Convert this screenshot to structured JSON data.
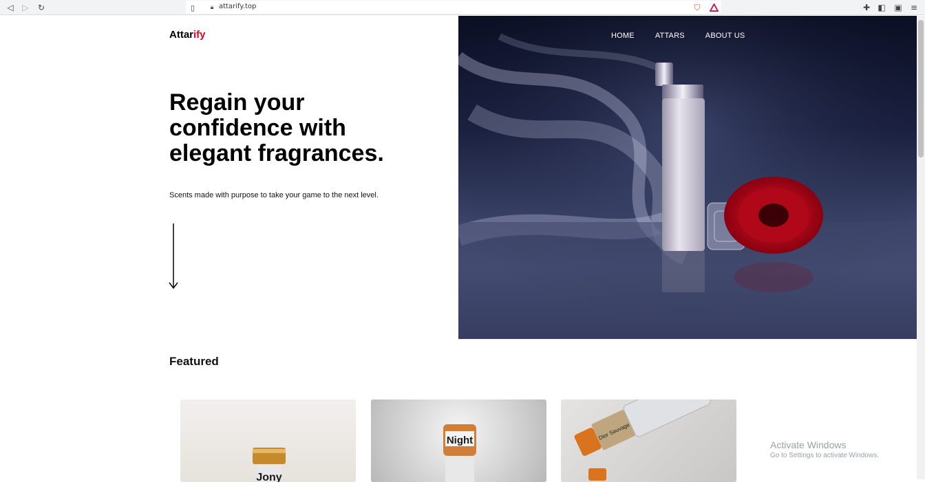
{
  "browser": {
    "url": "attarify.top"
  },
  "site": {
    "logo_main": "Attar",
    "logo_accent": "ify",
    "nav": [
      "HOME",
      "ATTARS",
      "ABOUT US"
    ]
  },
  "hero": {
    "title": "Regain your confidence with elegant fragrances.",
    "subtitle": "Scents made with purpose to take your game to the next level."
  },
  "featured": {
    "title": "Featured",
    "cards": [
      {
        "label": "Jony"
      },
      {
        "label": "Night"
      },
      {
        "label": "Dior Sauvage"
      }
    ]
  },
  "watermark": {
    "line1": "Activate Windows",
    "line2": "Go to Settings to activate Windows."
  },
  "colors": {
    "accent": "#e5001c"
  }
}
